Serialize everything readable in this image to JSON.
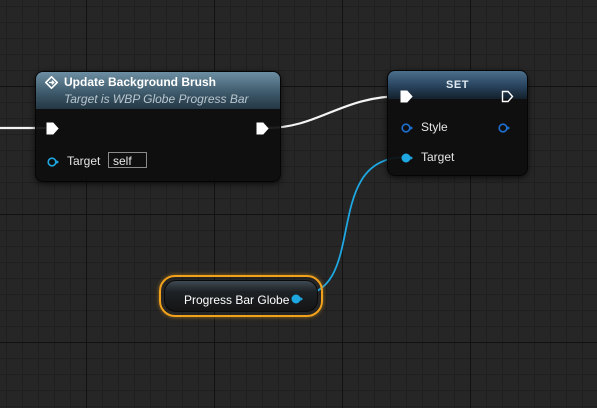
{
  "update_node": {
    "title": "Update Background Brush",
    "subtitle": "Target is WBP Globe Progress Bar",
    "target_label": "Target",
    "target_value": "self"
  },
  "set_node": {
    "title": "SET",
    "style_label": "Style",
    "target_label": "Target"
  },
  "var_node": {
    "label": "Progress Bar Globe"
  },
  "colors": {
    "exec_wire": "#ffffff",
    "object_wire": "#1ea7e1",
    "selection": "#f2a21a"
  }
}
